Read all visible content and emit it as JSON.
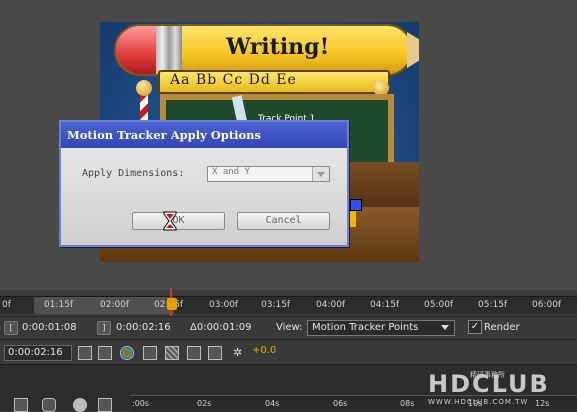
{
  "comp": {
    "sign_title": "Writing!",
    "alphabet": "Aa Bb Cc Dd Ee",
    "track_point_label": "Track Point 1"
  },
  "dialog": {
    "title": "Motion Tracker Apply Options",
    "apply_dimensions_label": "Apply Dimensions:",
    "apply_dimensions_value": "X and Y",
    "ok_label": "OK",
    "cancel_label": "Cancel"
  },
  "ruler": {
    "ticks": [
      "0f",
      "01:15f",
      "02:00f",
      "02:15f",
      "03:00f",
      "03:15f",
      "04:00f",
      "04:15f",
      "05:00f",
      "05:15f",
      "06:00f"
    ]
  },
  "controls": {
    "in_time": "0:00:01:08",
    "out_time": "0:00:02:16",
    "duration": "Δ0:00:01:09",
    "view_label": "View:",
    "view_value": "Motion Tracker Points",
    "render_label": "Render",
    "current_time": "0:00:02:16",
    "exposure_value": "+0.0"
  },
  "bottom_ruler": {
    "ticks": [
      ":00s",
      "02s",
      "04s",
      "06s",
      "08s",
      "10s",
      "12s"
    ]
  },
  "watermark": {
    "brand": "HDCLUB",
    "chinese": "精研事務所",
    "url": "WWW.HDCLUB.COM.TW"
  },
  "colors": {
    "dialog_title_bg": "#3a50c0",
    "playhead": "#e03030",
    "exposure": "#e0b000"
  }
}
